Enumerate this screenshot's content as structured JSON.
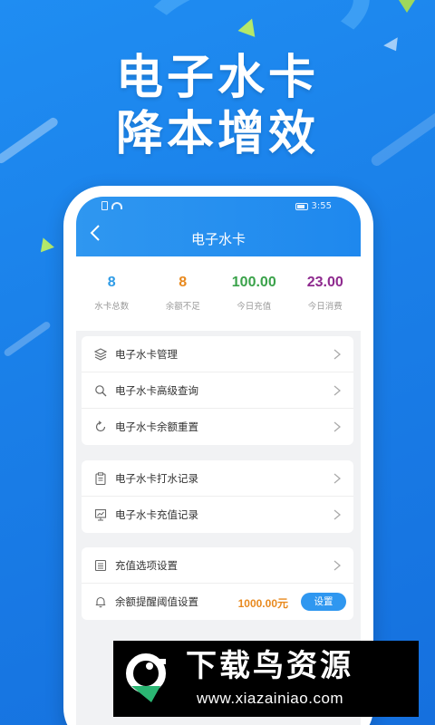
{
  "promo": {
    "line1": "电子水卡",
    "line2": "降本增效"
  },
  "statusbar": {
    "time": "3:55"
  },
  "appbar": {
    "title": "电子水卡"
  },
  "stats": [
    {
      "value": "8",
      "label": "水卡总数",
      "color": "#2e9be6"
    },
    {
      "value": "8",
      "label": "余额不足",
      "color": "#e8891e"
    },
    {
      "value": "100.00",
      "label": "今日充值",
      "color": "#3aa24a"
    },
    {
      "value": "23.00",
      "label": "今日消费",
      "color": "#8e2a8e"
    }
  ],
  "menu_group1": [
    {
      "label": "电子水卡管理",
      "icon": "layers-icon"
    },
    {
      "label": "电子水卡高级查询",
      "icon": "search-icon"
    },
    {
      "label": "电子水卡余额重置",
      "icon": "refresh-icon"
    }
  ],
  "menu_group2": [
    {
      "label": "电子水卡打水记录",
      "icon": "clipboard-icon"
    },
    {
      "label": "电子水卡充值记录",
      "icon": "chart-board-icon"
    }
  ],
  "menu_group3": {
    "options": {
      "label": "充值选项设置",
      "icon": "list-settings-icon"
    },
    "alert": {
      "label": "余额提醒阈值设置",
      "icon": "bell-icon",
      "value": "1000.00元",
      "button": "设置"
    }
  },
  "watermark": {
    "title": "下载鸟资源",
    "url": "www.xiazainiao.com"
  }
}
